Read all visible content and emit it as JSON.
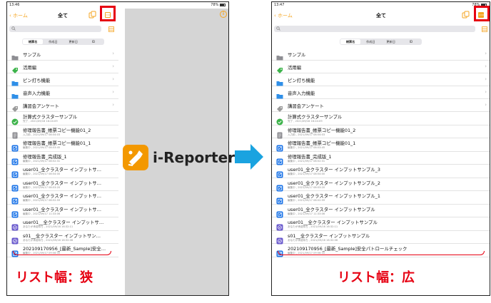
{
  "left": {
    "status": {
      "time": "13:46",
      "battery": "78%"
    },
    "nav": {
      "back_label": "ホーム",
      "title": "全て"
    },
    "segments": [
      {
        "label": "帳票名",
        "active": true
      },
      {
        "label": "作成日",
        "active": false
      },
      {
        "label": "更新日",
        "active": false
      },
      {
        "label": "ID",
        "active": false
      }
    ],
    "folders": [
      {
        "label": "サンプル",
        "icon": "folder-icon-gray"
      },
      {
        "label": "活用編",
        "icon": "tag-icon-green"
      },
      {
        "label": "ピン打ち機能",
        "icon": "folder-icon-blue"
      },
      {
        "label": "音声入力機能",
        "icon": "folder-icon-blue"
      },
      {
        "label": "講習会アンケート",
        "icon": "tag-icon-gray"
      }
    ],
    "reports": [
      {
        "name": "計算式クラスターサンプル",
        "sub": "完了 , 2021/09/16 16:24:09",
        "icon": "check-doc-icon"
      },
      {
        "name": "修理報告書_帳票コピー機能01_2",
        "sub": "入力前 , 2021/09/17 08:54:03",
        "icon": "gray-doc-icon"
      },
      {
        "name": "修理報告書_帳票コピー機能01_1",
        "sub": "編集中 , 2021/09/17 08:53:45",
        "icon": "edit-doc-icon"
      },
      {
        "name": "修理報告書_完成版_1",
        "sub": "編集中 , 2021/09/17 08:52:31",
        "icon": "edit-doc-icon"
      },
      {
        "name": "user01_全クラスター インプットサ…",
        "sub": "編集中 , 2021/09/17 08:54:00",
        "icon": "edit-doc-icon"
      },
      {
        "name": "user01_全クラスター インプットサ…",
        "sub": "編集中 , 2021/09/17 08:53:20",
        "icon": "edit-doc-icon"
      },
      {
        "name": "user01_全クラスター インプットサ…",
        "sub": "編集中 , 2021/09/17 08:52:59",
        "icon": "edit-doc-icon"
      },
      {
        "name": "user01_全クラスター インプットサ…",
        "sub": "編集中 , 2021/09/17 11:33:06",
        "icon": "edit-doc-icon"
      },
      {
        "name": "user01__全クラスター インプットサ…",
        "sub": "あなたが承認待ち , 2021/09/16 16:32:11",
        "icon": "approve-doc-icon"
      },
      {
        "name": "s01__全クラスター インプットサン…",
        "sub": "あなたが承認待ち , 2021/09/16 16:32:06",
        "icon": "approve-doc-icon"
      },
      {
        "name": "202109170956_[最新_Sample]安全…",
        "sub": "編集中 , 2021/09/17 09:56:35",
        "icon": "edit-doc-icon"
      }
    ],
    "caption": "リスト幅：狭"
  },
  "right": {
    "status": {
      "time": "13:47",
      "battery": "78%"
    },
    "nav": {
      "back_label": "ホーム",
      "title": "全て"
    },
    "segments": [
      {
        "label": "帳票名",
        "active": true
      },
      {
        "label": "作成日",
        "active": false
      },
      {
        "label": "更新日",
        "active": false
      },
      {
        "label": "ID",
        "active": false
      }
    ],
    "folders": [
      {
        "label": "サンプル",
        "icon": "folder-icon-gray"
      },
      {
        "label": "活用編",
        "icon": "tag-icon-green"
      },
      {
        "label": "ピン打ち機能",
        "icon": "folder-icon-blue"
      },
      {
        "label": "音声入力機能",
        "icon": "folder-icon-blue"
      },
      {
        "label": "講習会アンケート",
        "icon": "tag-icon-gray"
      }
    ],
    "reports": [
      {
        "name": "計算式クラスターサンプル",
        "sub": "完了 , 2021/09/16 16:24:09",
        "icon": "check-doc-icon"
      },
      {
        "name": "修理報告書_帳票コピー機能01_2",
        "sub": "入力前 , 2021/09/17 08:54:03",
        "icon": "gray-doc-icon"
      },
      {
        "name": "修理報告書_帳票コピー機能01_1",
        "sub": "編集中 , 2021/09/17 08:53:45",
        "icon": "edit-doc-icon"
      },
      {
        "name": "修理報告書_完成版_1",
        "sub": "編集中 , 2021/09/17 08:52:31",
        "icon": "edit-doc-icon"
      },
      {
        "name": "user01_全クラスター インプットサンプル_3",
        "sub": "編集中 , 2021/09/17 08:54:00",
        "icon": "edit-doc-icon"
      },
      {
        "name": "user01_全クラスター インプットサンプル_2",
        "sub": "編集中 , 2021/09/17 08:53:20",
        "icon": "edit-doc-icon"
      },
      {
        "name": "user01_全クラスター インプットサンプル_1",
        "sub": "編集中 , 2021/09/17 08:52:59",
        "icon": "edit-doc-icon"
      },
      {
        "name": "user01_全クラスター インプットサンプル",
        "sub": "編集中 , 2021/09/17 11:33:06",
        "icon": "edit-doc-icon"
      },
      {
        "name": "user01__全クラスター インプットサンプル",
        "sub": "あなたが承認待ち , 2021/09/16 16:32:11",
        "icon": "approve-doc-icon"
      },
      {
        "name": "s01__全クラスター インプットサンプル",
        "sub": "あなたが承認待ち , 2021/09/16 16:32:06",
        "icon": "approve-doc-icon"
      },
      {
        "name": "202109170956_[最新_Sample]安全パトロールチェック",
        "sub": "編集中 , 2021/09/17 09:56:35",
        "icon": "edit-doc-icon"
      }
    ],
    "caption": "リスト幅：広"
  },
  "logo": {
    "text": "i-Reporter"
  },
  "colors": {
    "accent": "#f5a623",
    "highlight": "#e60012",
    "arrow": "#1aa3e0",
    "logo_bg": "#f39800"
  }
}
